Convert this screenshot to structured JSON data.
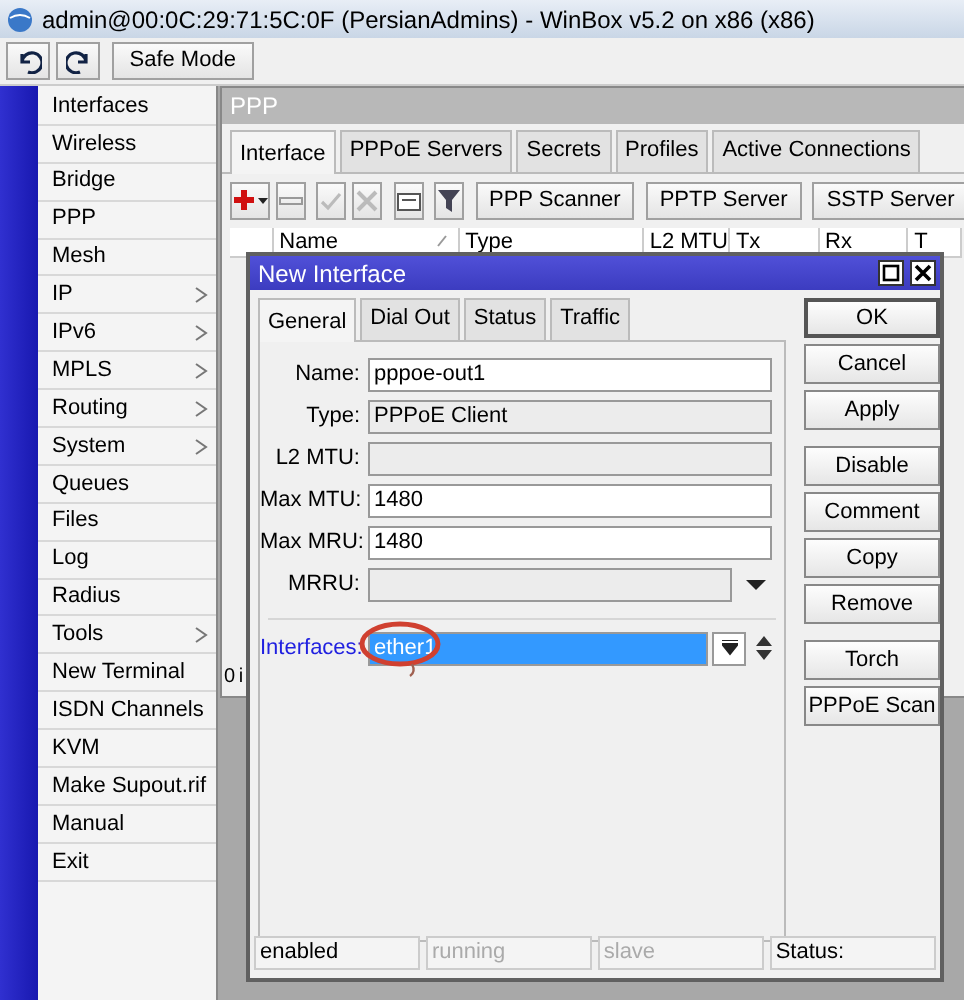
{
  "window": {
    "title": "admin@00:0C:29:71:5C:0F (PersianAdmins) - WinBox v5.2 on x86 (x86)"
  },
  "toolbar": {
    "safe_mode": "Safe Mode"
  },
  "sidebar": {
    "items": [
      {
        "label": "Interfaces",
        "submenu": false
      },
      {
        "label": "Wireless",
        "submenu": false
      },
      {
        "label": "Bridge",
        "submenu": false
      },
      {
        "label": "PPP",
        "submenu": false
      },
      {
        "label": "Mesh",
        "submenu": false
      },
      {
        "label": "IP",
        "submenu": true
      },
      {
        "label": "IPv6",
        "submenu": true
      },
      {
        "label": "MPLS",
        "submenu": true
      },
      {
        "label": "Routing",
        "submenu": true
      },
      {
        "label": "System",
        "submenu": true
      },
      {
        "label": "Queues",
        "submenu": false
      },
      {
        "label": "Files",
        "submenu": false
      },
      {
        "label": "Log",
        "submenu": false
      },
      {
        "label": "Radius",
        "submenu": false
      },
      {
        "label": "Tools",
        "submenu": true
      },
      {
        "label": "New Terminal",
        "submenu": false
      },
      {
        "label": "ISDN Channels",
        "submenu": false
      },
      {
        "label": "KVM",
        "submenu": false
      },
      {
        "label": "Make Supout.rif",
        "submenu": false
      },
      {
        "label": "Manual",
        "submenu": false
      },
      {
        "label": "Exit",
        "submenu": false
      }
    ]
  },
  "ppp_window": {
    "title": "PPP",
    "tabs": [
      {
        "label": "Interface",
        "selected": true
      },
      {
        "label": "PPPoE Servers",
        "selected": false
      },
      {
        "label": "Secrets",
        "selected": false
      },
      {
        "label": "Profiles",
        "selected": false
      },
      {
        "label": "Active Connections",
        "selected": false
      }
    ],
    "toolbar_buttons": [
      "PPP Scanner",
      "PPTP Server",
      "SSTP Server"
    ],
    "table": {
      "columns": [
        "Name",
        "Type",
        "L2 MTU",
        "Tx",
        "Rx",
        "T"
      ]
    },
    "status": "0 i"
  },
  "dialog": {
    "title": "New Interface",
    "tabs": [
      {
        "label": "General",
        "selected": true
      },
      {
        "label": "Dial Out",
        "selected": false
      },
      {
        "label": "Status",
        "selected": false
      },
      {
        "label": "Traffic",
        "selected": false
      }
    ],
    "fields": [
      {
        "label": "Name:",
        "value": "pppoe-out1",
        "disabled": false,
        "dropdown": false
      },
      {
        "label": "Type:",
        "value": "PPPoE Client",
        "disabled": true,
        "dropdown": false
      },
      {
        "label": "L2 MTU:",
        "disabled": true,
        "dropdown": false
      },
      {
        "label": "Max MTU:",
        "value": "1480",
        "disabled": false,
        "dropdown": false
      },
      {
        "label": "Max MRU:",
        "value": "1480",
        "disabled": false,
        "dropdown": false
      },
      {
        "label": "MRRU:",
        "disabled": true,
        "dropdown": true
      }
    ],
    "interfaces": {
      "label": "Interfaces:",
      "value": "ether1",
      "selected": true
    },
    "button_groups": [
      [
        "OK",
        "Cancel",
        "Apply"
      ],
      [
        "Disable",
        "Comment",
        "Copy",
        "Remove"
      ],
      [
        "Torch",
        "PPPoE Scan"
      ]
    ],
    "status_bar": [
      {
        "text": "enabled",
        "disabled": false
      },
      {
        "text": "running",
        "disabled": true
      },
      {
        "text": "slave",
        "disabled": true
      },
      {
        "text": "Status:",
        "disabled": false
      }
    ]
  }
}
